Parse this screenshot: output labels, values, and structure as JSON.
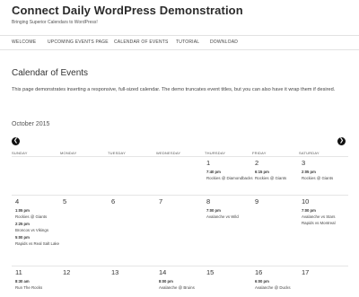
{
  "site": {
    "title": "Connect Daily WordPress Demonstration",
    "tagline": "Bringing Superior Calendars to WordPress!"
  },
  "nav": [
    "WELCOME",
    "UPCOMING EVENTS PAGE",
    "CALENDAR OF EVENTS",
    "TUTORIAL",
    "DOWNLOAD"
  ],
  "page": {
    "title": "Calendar of Events",
    "intro": "This page demonstrates inserting a responsive, full-sized calendar. The demo truncates event titles, but you can also have it wrap them if desired."
  },
  "calendar": {
    "month": "October 2015",
    "prev_icon": "chevron-left-icon",
    "next_icon": "chevron-right-icon",
    "weekdays": [
      "SUNDAY",
      "MONDAY",
      "TUESDAY",
      "WEDNESDAY",
      "THURSDAY",
      "FRIDAY",
      "SATURDAY"
    ],
    "weeks": [
      [
        {
          "day": "",
          "events": []
        },
        {
          "day": "",
          "events": []
        },
        {
          "day": "",
          "events": []
        },
        {
          "day": "",
          "events": []
        },
        {
          "day": "1",
          "events": [
            {
              "time": "7:40 pm",
              "title": "Rockies @ Diamondbacks"
            }
          ]
        },
        {
          "day": "2",
          "events": [
            {
              "time": "6:15 pm",
              "title": "Rockies @ Giants"
            }
          ]
        },
        {
          "day": "3",
          "events": [
            {
              "time": "2:05 pm",
              "title": "Rockies @ Giants"
            }
          ]
        }
      ],
      [
        {
          "day": "4",
          "events": [
            {
              "time": "1:05 pm",
              "title": "Rockies @ Giants"
            },
            {
              "time": "2:25 pm",
              "title": "Broncos vs Vikings"
            },
            {
              "time": "5:00 pm",
              "title": "Rapids vs Real Salt Lake"
            }
          ]
        },
        {
          "day": "5",
          "events": []
        },
        {
          "day": "6",
          "events": []
        },
        {
          "day": "7",
          "events": []
        },
        {
          "day": "8",
          "events": [
            {
              "time": "7:00 pm",
              "title": "Avalanche vs Wild"
            }
          ]
        },
        {
          "day": "9",
          "events": []
        },
        {
          "day": "10",
          "events": [
            {
              "time": "7:00 pm",
              "title": "Avalanche vs Stars"
            },
            {
              "time": "",
              "title": "Rapids vs Montreal"
            }
          ]
        }
      ],
      [
        {
          "day": "11",
          "events": [
            {
              "time": "8:30 am",
              "title": "Run The Rocks"
            }
          ]
        },
        {
          "day": "12",
          "events": []
        },
        {
          "day": "13",
          "events": []
        },
        {
          "day": "14",
          "events": [
            {
              "time": "8:00 pm",
              "title": "Avalanche @ Bruins"
            }
          ]
        },
        {
          "day": "15",
          "events": []
        },
        {
          "day": "16",
          "events": [
            {
              "time": "6:00 pm",
              "title": "Avalanche @ Ducks"
            }
          ]
        },
        {
          "day": "17",
          "events": []
        }
      ]
    ]
  }
}
